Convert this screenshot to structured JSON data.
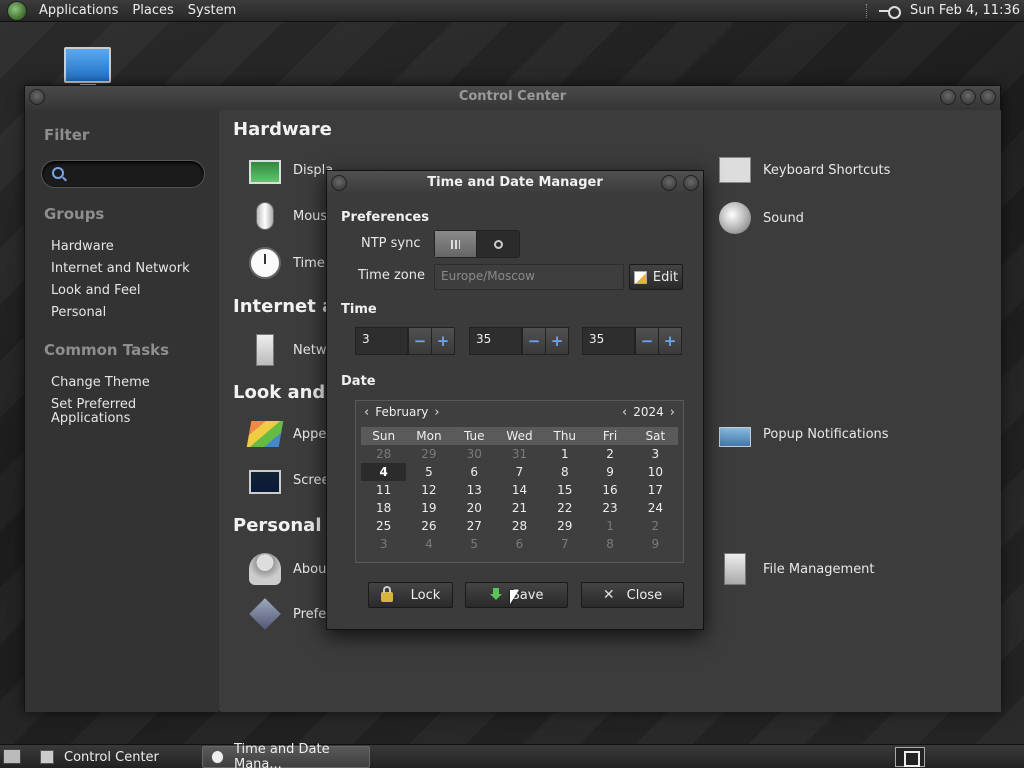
{
  "top_panel": {
    "menus": [
      "Applications",
      "Places",
      "System"
    ],
    "clock": "Sun Feb  4, 11:36"
  },
  "control_center": {
    "title": "Control Center",
    "sidebar": {
      "filter_heading": "Filter",
      "groups_heading": "Groups",
      "groups": [
        "Hardware",
        "Internet and Network",
        "Look and Feel",
        "Personal"
      ],
      "tasks_heading": "Common Tasks",
      "tasks": [
        "Change Theme",
        "Set Preferred Applications"
      ]
    },
    "sections": {
      "hardware": "Hardware",
      "internet": "Internet ar",
      "look": "Look and",
      "personal": "Personal"
    },
    "items": {
      "display": "Displa",
      "mouse": "Mous",
      "time": "Time",
      "network": "Netw",
      "appearance": "Appe",
      "screensaver": "Scree",
      "about": "Abou",
      "preferred": "Prefe",
      "keyboard_shortcuts": "Keyboard Shortcuts",
      "sound": "Sound",
      "popup_notifications": "Popup Notifications",
      "file_management": "File Management"
    }
  },
  "dialog": {
    "title": "Time and Date Manager",
    "preferences_heading": "Preferences",
    "ntp_label": "NTP sync",
    "ntp_enabled": true,
    "timezone_label": "Time zone",
    "timezone_placeholder": "Europe/Moscow",
    "edit_label": "Edit",
    "time_heading": "Time",
    "hours": "3",
    "minutes": "35",
    "seconds": "35",
    "minus": "−",
    "plus": "+",
    "date_heading": "Date",
    "calendar": {
      "month": "February",
      "year": "2024",
      "prev": "‹",
      "next": "›",
      "weekdays": [
        "Sun",
        "Mon",
        "Tue",
        "Wed",
        "Thu",
        "Fri",
        "Sat"
      ],
      "days": [
        [
          "28",
          "29",
          "30",
          "31",
          "1",
          "2",
          "3"
        ],
        [
          "4",
          "5",
          "6",
          "7",
          "8",
          "9",
          "10"
        ],
        [
          "11",
          "12",
          "13",
          "14",
          "15",
          "16",
          "17"
        ],
        [
          "18",
          "19",
          "20",
          "21",
          "22",
          "23",
          "24"
        ],
        [
          "25",
          "26",
          "27",
          "28",
          "29",
          "1",
          "2"
        ],
        [
          "3",
          "4",
          "5",
          "6",
          "7",
          "8",
          "9"
        ]
      ],
      "selected_day": "4"
    },
    "lock_label": "Lock",
    "save_label": "Save",
    "close_label": "Close"
  },
  "taskbar": {
    "tasks": [
      "Control Center",
      "Time and Date Mana..."
    ]
  }
}
